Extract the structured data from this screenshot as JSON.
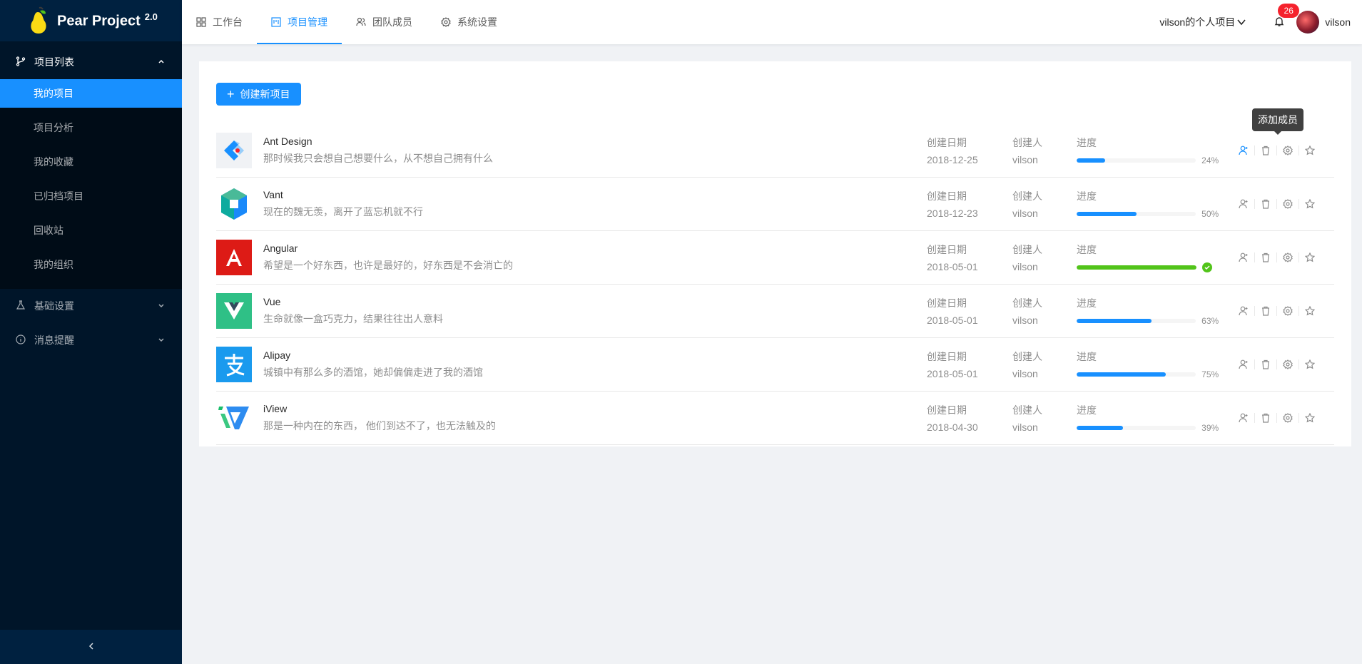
{
  "app": {
    "name": "Pear Project",
    "version": "2.0"
  },
  "sidebar": {
    "groups": [
      {
        "label": "项目列表",
        "icon": "branch-icon",
        "expanded": true
      },
      {
        "label": "基础设置",
        "icon": "flask-icon",
        "expanded": false
      },
      {
        "label": "消息提醒",
        "icon": "info-circle-icon",
        "expanded": false
      }
    ],
    "items": [
      {
        "label": "我的项目",
        "active": true
      },
      {
        "label": "项目分析"
      },
      {
        "label": "我的收藏"
      },
      {
        "label": "已归档项目"
      },
      {
        "label": "回收站"
      },
      {
        "label": "我的组织"
      }
    ]
  },
  "header": {
    "tabs": [
      {
        "label": "工作台",
        "icon": "appstore-icon"
      },
      {
        "label": "项目管理",
        "icon": "project-icon",
        "active": true
      },
      {
        "label": "团队成员",
        "icon": "team-icon"
      },
      {
        "label": "系统设置",
        "icon": "setting-icon"
      }
    ],
    "org": "vilson的个人项目",
    "notifications": "26",
    "username": "vilson"
  },
  "main": {
    "create_button": "创建新项目",
    "tooltip": "添加成员",
    "labels": {
      "date": "创建日期",
      "creator": "创建人",
      "progress": "进度"
    },
    "projects": [
      {
        "name": "Ant Design",
        "desc": "那时候我只会想自己想要什么，从不想自己拥有什么",
        "date": "2018-12-25",
        "creator": "vilson",
        "progress": 24,
        "progress_text": "24%"
      },
      {
        "name": "Vant",
        "desc": "现在的魏无羡，离开了蓝忘机就不行",
        "date": "2018-12-23",
        "creator": "vilson",
        "progress": 50,
        "progress_text": "50%"
      },
      {
        "name": "Angular",
        "desc": "希望是一个好东西，也许是最好的，好东西是不会消亡的",
        "date": "2018-05-01",
        "creator": "vilson",
        "progress": 100,
        "progress_text": ""
      },
      {
        "name": "Vue",
        "desc": "生命就像一盒巧克力，结果往往出人意料",
        "date": "2018-05-01",
        "creator": "vilson",
        "progress": 63,
        "progress_text": "63%"
      },
      {
        "name": "Alipay",
        "desc": "城镇中有那么多的酒馆，她却偏偏走进了我的酒馆",
        "date": "2018-05-01",
        "creator": "vilson",
        "progress": 75,
        "progress_text": "75%"
      },
      {
        "name": "iView",
        "desc": "那是一种内在的东西， 他们到达不了，也无法触及的",
        "date": "2018-04-30",
        "creator": "vilson",
        "progress": 39,
        "progress_text": "39%"
      }
    ]
  },
  "colors": {
    "primary": "#1890ff",
    "sider": "#001529",
    "success": "#52c41a",
    "danger": "#f5222d"
  }
}
